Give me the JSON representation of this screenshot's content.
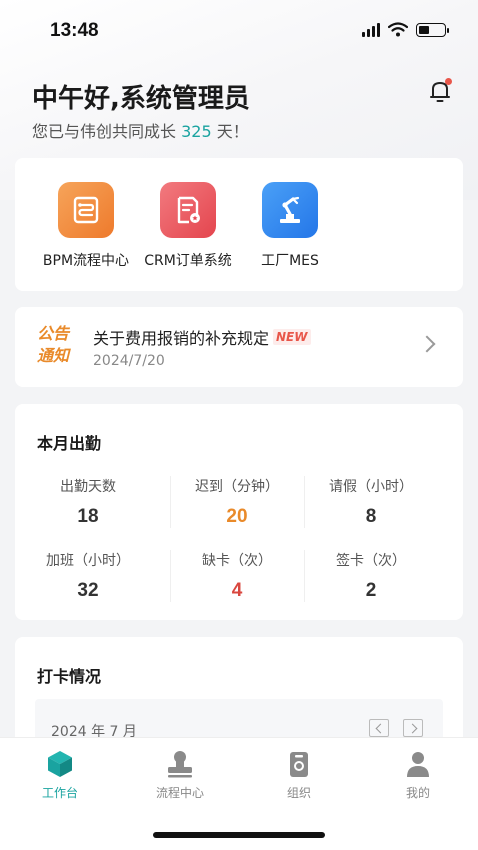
{
  "status": {
    "time": "13:48"
  },
  "header": {
    "greeting": "中午好,系统管理员",
    "sub_prefix": "您已与伟创共同成长",
    "days": "325",
    "sub_suffix": "天！"
  },
  "apps": [
    {
      "label": "BPM流程中心",
      "icon": "workflow-icon",
      "color": "#f08a3c"
    },
    {
      "label": "CRM订单系统",
      "icon": "order-icon",
      "color": "#e9505a"
    },
    {
      "label": "工厂MES",
      "icon": "robot-arm-icon",
      "color": "#2f86f0"
    }
  ],
  "notice": {
    "tag_line1": "公告",
    "tag_line2": "通知",
    "title": "关于费用报销的补充规定",
    "badge": "NEW",
    "date": "2024/7/20"
  },
  "attendance": {
    "title": "本月出勤",
    "stats": [
      {
        "label": "出勤天数",
        "value": "18",
        "color": "#333333"
      },
      {
        "label": "迟到（分钟）",
        "value": "20",
        "color": "#e98a2a"
      },
      {
        "label": "请假（小时）",
        "value": "8",
        "color": "#333333"
      },
      {
        "label": "加班（小时）",
        "value": "32",
        "color": "#333333"
      },
      {
        "label": "缺卡（次）",
        "value": "4",
        "color": "#d9473f"
      },
      {
        "label": "签卡（次）",
        "value": "2",
        "color": "#333333"
      }
    ]
  },
  "clock": {
    "title": "打卡情况",
    "month": "2024 年 7 月"
  },
  "tabs": [
    {
      "label": "工作台",
      "icon": "cube-icon",
      "active": true
    },
    {
      "label": "流程中心",
      "icon": "stamp-icon",
      "active": false
    },
    {
      "label": "组织",
      "icon": "badge-icon",
      "active": false
    },
    {
      "label": "我的",
      "icon": "user-icon",
      "active": false
    }
  ],
  "colors": {
    "accent": "#1aa3a0",
    "warning": "#e98a2a",
    "danger": "#d9473f"
  }
}
